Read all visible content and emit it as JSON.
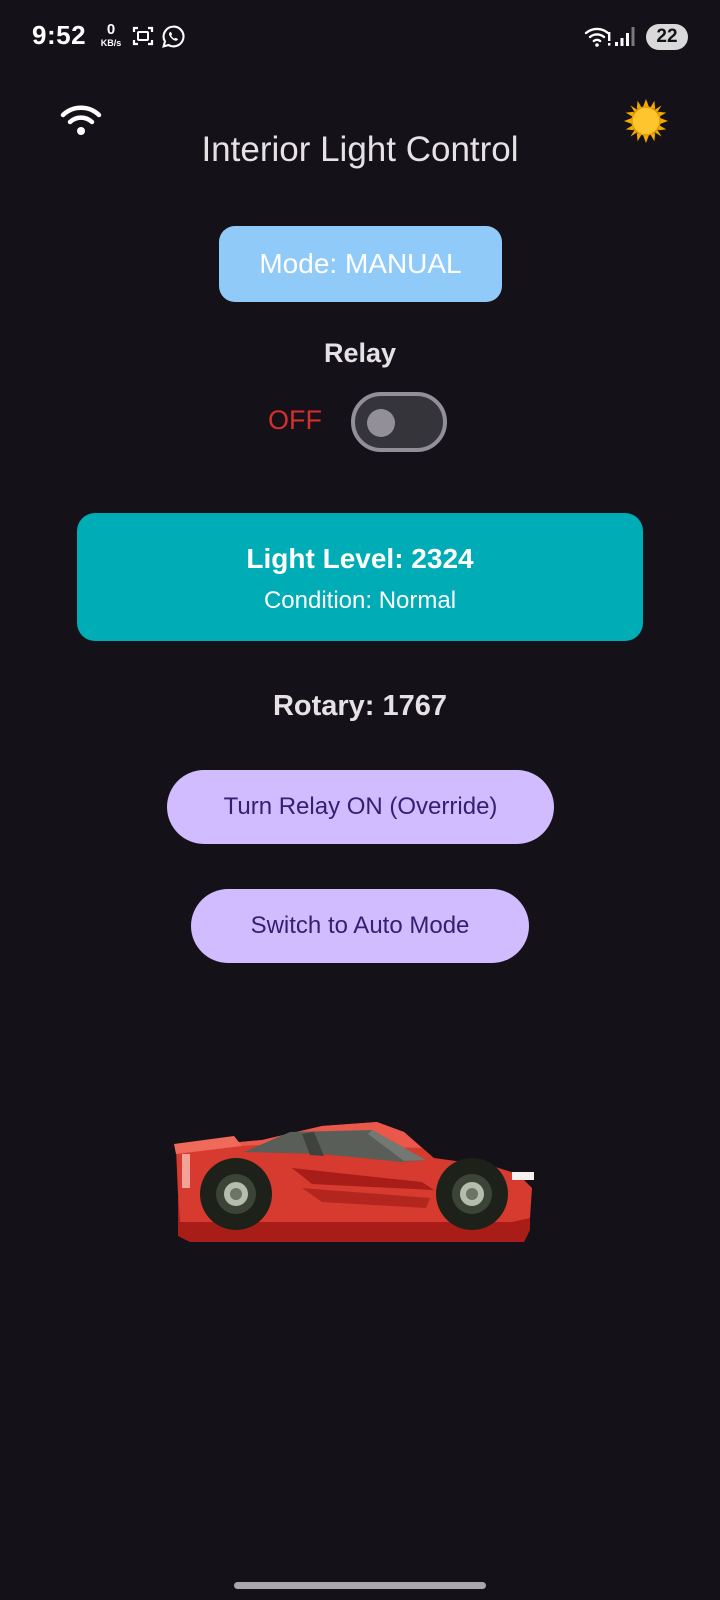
{
  "status_bar": {
    "time": "9:52",
    "net_speed_value": "0",
    "net_speed_unit": "KB/s",
    "battery": "22",
    "icons": [
      "screenshot-icon",
      "whatsapp-icon",
      "wifi-icon",
      "signal-icon"
    ]
  },
  "header": {
    "title": "Interior Light Control",
    "left_icon": "wifi-icon",
    "right_icon": "sun-icon"
  },
  "mode": {
    "label": "Mode: MANUAL",
    "color": "#90caf9"
  },
  "relay": {
    "label": "Relay",
    "state": "OFF",
    "state_color": "#d32f2f",
    "switch_on": false
  },
  "light": {
    "level": "Light Level: 2324",
    "condition": "Condition: Normal",
    "card_color": "#00acb5"
  },
  "rotary": {
    "label": "Rotary: 1767"
  },
  "buttons": {
    "override": "Turn Relay ON (Override)",
    "auto_mode": "Switch to Auto Mode",
    "color": "#d0bcff",
    "text_color": "#381e72"
  },
  "illustration": {
    "name": "red-sports-car",
    "body_color": "#d73a2f"
  }
}
